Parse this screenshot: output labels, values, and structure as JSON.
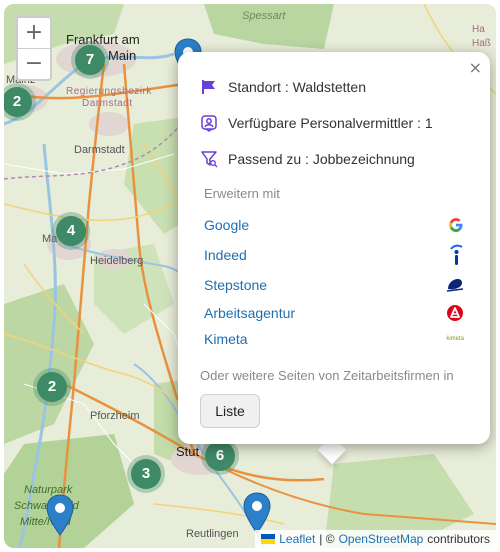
{
  "map": {
    "labels": {
      "spessart": "Spessart",
      "frankfurt": "Frankfurt am",
      "frankfurt2": "Main",
      "mainz": "Mainz",
      "regbez": "Regierungsbezirk",
      "darmstadt_region": "Darmstadt",
      "darmstadt": "Darmstadt",
      "heidelberg": "Heidelberg",
      "mannheim": "Ma",
      "pforzheim": "Pforzheim",
      "naturpark1": "Naturpark",
      "naturpark2": "Schwarzwald",
      "naturpark3": "Mitte/Nord",
      "stuttgart": "Stut",
      "reutlingen": "Reutlingen",
      "hass": "Haß",
      "ha": "Ha"
    },
    "zoom": {
      "in": "+",
      "out": "−"
    },
    "clusters": [
      {
        "count": "7"
      },
      {
        "count": "2"
      },
      {
        "count": "4"
      },
      {
        "count": "2"
      },
      {
        "count": "3"
      },
      {
        "count": "6"
      }
    ]
  },
  "popup": {
    "close": "×",
    "location": "Standort : Waldstetten",
    "available": "Verfügbare Personalvermittler : 1",
    "matches": "Passend zu : Jobbezeichnung",
    "extend_label": "Erweitern mit",
    "providers": [
      {
        "name": "Google",
        "icon": "google-logo"
      },
      {
        "name": "Indeed",
        "icon": "indeed-logo"
      },
      {
        "name": "Stepstone",
        "icon": "stepstone-logo"
      },
      {
        "name": "Arbeitsagentur",
        "icon": "arbeitsagentur-logo"
      },
      {
        "name": "Kimeta",
        "icon": "kimeta-logo",
        "logo_text": "kimeta"
      }
    ],
    "other_sites": "Oder weitere Seiten von Zeitarbeitsfirmen in",
    "list_button": "Liste",
    "accent": "#6a3fd8",
    "link_color": "#1f6fb2"
  },
  "attribution": {
    "leaflet": "Leaflet",
    "sep": "| ©",
    "osm": "OpenStreetMap",
    "contributors": "contributors"
  }
}
